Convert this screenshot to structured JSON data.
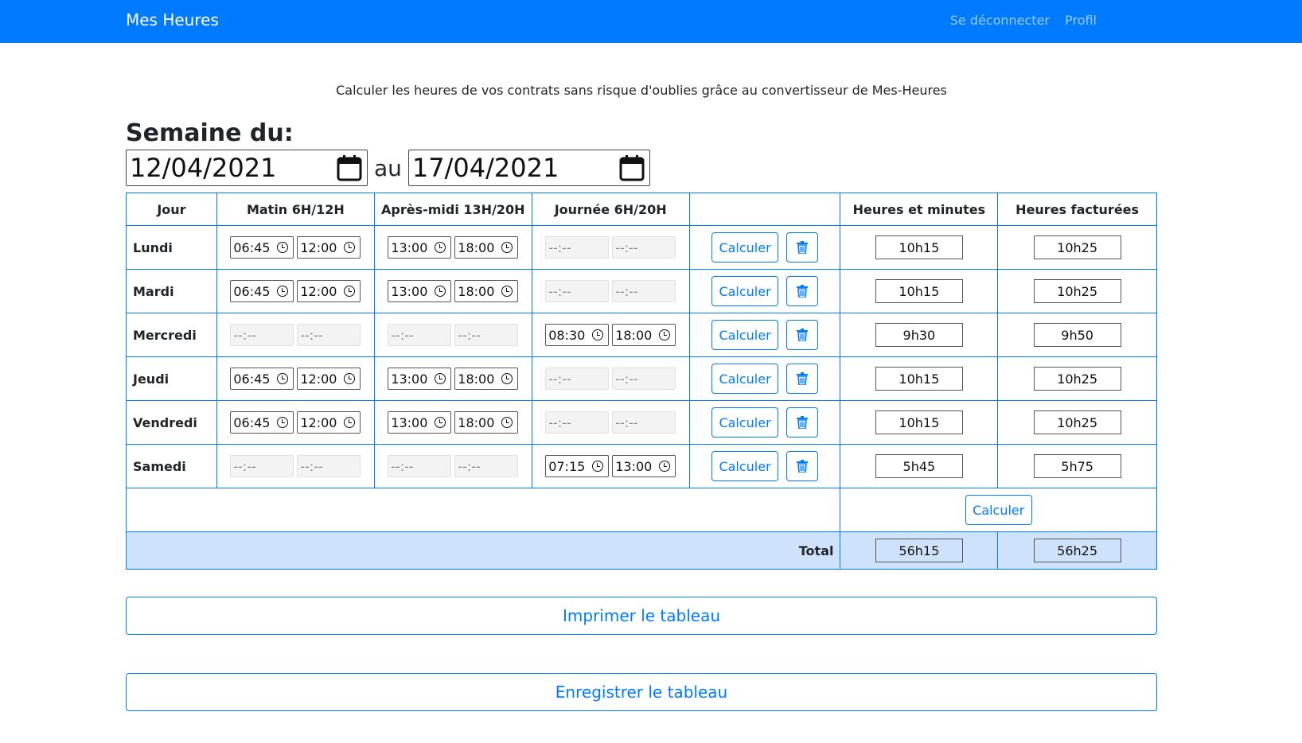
{
  "nav": {
    "brand": "Mes Heures",
    "logout": "Se déconnecter",
    "profile": "Profil"
  },
  "intro": "Calculer les heures de vos contrats sans risque d'oublies grâce au convertisseur de Mes-Heures",
  "week": {
    "title": "Semaine du:",
    "start": "12/04/2021",
    "separator": "au",
    "end": "17/04/2021"
  },
  "table": {
    "headers": [
      "Jour",
      "Matin 6H/12H",
      "Après-midi 13H/20H",
      "Journée 6H/20H",
      "",
      "Heures et minutes",
      "Heures facturées"
    ],
    "empty_time": "--:--",
    "calc_label": "Calculer",
    "rows": [
      {
        "day": "Lundi",
        "matin": [
          "06:45",
          "12:00"
        ],
        "apres": [
          "13:00",
          "18:00"
        ],
        "journee": [
          "",
          ""
        ],
        "hm": "10h15",
        "hf": "10h25"
      },
      {
        "day": "Mardi",
        "matin": [
          "06:45",
          "12:00"
        ],
        "apres": [
          "13:00",
          "18:00"
        ],
        "journee": [
          "",
          ""
        ],
        "hm": "10h15",
        "hf": "10h25"
      },
      {
        "day": "Mercredi",
        "matin": [
          "",
          ""
        ],
        "apres": [
          "",
          ""
        ],
        "journee": [
          "08:30",
          "18:00"
        ],
        "hm": "9h30",
        "hf": "9h50"
      },
      {
        "day": "Jeudi",
        "matin": [
          "06:45",
          "12:00"
        ],
        "apres": [
          "13:00",
          "18:00"
        ],
        "journee": [
          "",
          ""
        ],
        "hm": "10h15",
        "hf": "10h25"
      },
      {
        "day": "Vendredi",
        "matin": [
          "06:45",
          "12:00"
        ],
        "apres": [
          "13:00",
          "18:00"
        ],
        "journee": [
          "",
          ""
        ],
        "hm": "10h15",
        "hf": "10h25"
      },
      {
        "day": "Samedi",
        "matin": [
          "",
          ""
        ],
        "apres": [
          "",
          ""
        ],
        "journee": [
          "07:15",
          "13:00"
        ],
        "hm": "5h45",
        "hf": "5h75"
      }
    ],
    "total_calc_label": "Calculer",
    "total_label": "Total",
    "total_hm": "56h15",
    "total_hf": "56h25"
  },
  "buttons": {
    "print": "Imprimer le tableau",
    "save": "Enregistrer le tableau"
  },
  "colors": {
    "primary": "#007bff",
    "total_bg": "#cfe2fb"
  },
  "icons": {
    "date": "calendar-icon",
    "time": "clock-icon",
    "delete": "trash-icon"
  }
}
